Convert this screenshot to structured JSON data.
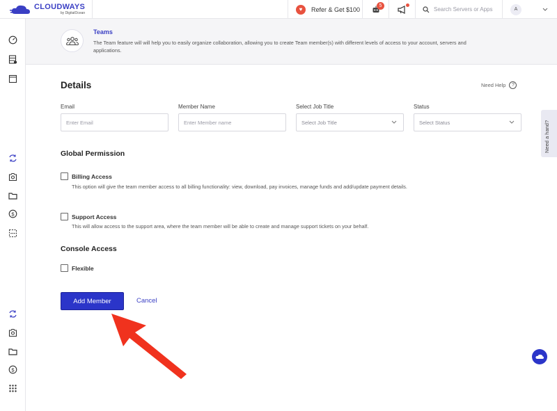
{
  "topbar": {
    "logo_name": "CLOUDWAYS",
    "logo_sub": "by DigitalOcean",
    "refer_label": "Refer & Get $100",
    "bot_badge": "5",
    "search_placeholder": "Search Servers or Apps",
    "avatar_initial": "A"
  },
  "info": {
    "title": "Teams",
    "description": "The Team feature will will help you to easily organize collaboration, allowing you to create Team member(s) with different levels of access to your account, servers and applications."
  },
  "form": {
    "title": "Details",
    "need_help": "Need Help",
    "email_label": "Email",
    "email_placeholder": "Enter Email",
    "name_label": "Member Name",
    "name_placeholder": "Enter Member name",
    "job_label": "Select Job Title",
    "job_value": "Select Job Title",
    "status_label": "Status",
    "status_value": "Select Status"
  },
  "global_permission": {
    "title": "Global Permission",
    "billing_label": "Billing Access",
    "billing_desc": "This option will give the team member access to all billing functionality: view, download, pay invoices, manage funds and add/update payment details.",
    "support_label": "Support Access",
    "support_desc": "This will allow access to the support area, where the team member will be able to create and manage support tickets on your behalf."
  },
  "console_access": {
    "title": "Console Access",
    "flexible_label": "Flexible"
  },
  "actions": {
    "add_member": "Add Member",
    "cancel": "Cancel"
  },
  "side_tab": {
    "label": "Need a hand?"
  },
  "colors": {
    "brand": "#3a3fc4",
    "primary_button": "#2b35c9",
    "annotation_arrow": "#f0321e"
  }
}
